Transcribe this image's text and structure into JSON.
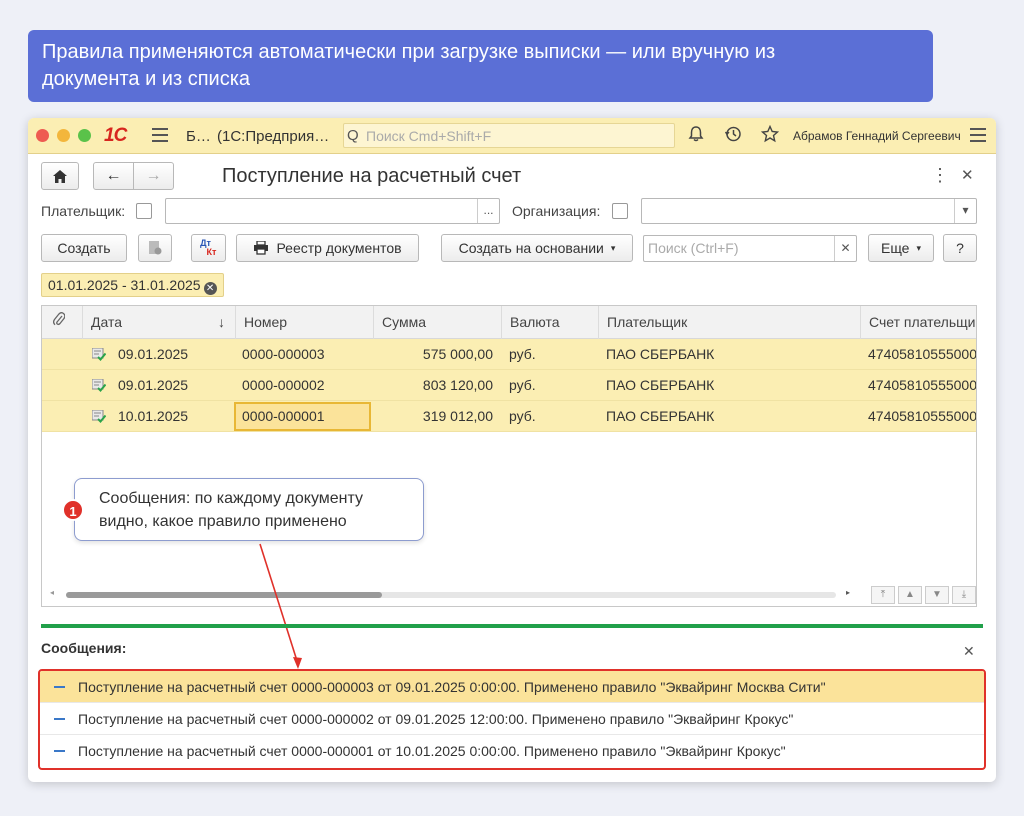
{
  "banner": {
    "line1": "Правила применяются автоматически при загрузке выписки — или вручную из",
    "line2": "документа и из списка"
  },
  "titlebar": {
    "logo": "1С",
    "app_short": "Б…",
    "app_name": "(1С:Предприя…",
    "search_placeholder": "Поиск Cmd+Shift+F",
    "user": "Абрамов Геннадий Сергеевич"
  },
  "form": {
    "title": "Поступление на расчетный счет",
    "payer_label": "Плательщик:",
    "org_label": "Организация:",
    "payer_select": "...",
    "create_label": "Создать",
    "dt_kt_top": "Дт",
    "dt_kt_bottom": "Кт",
    "registry_label": "Реестр документов",
    "create_based_label": "Создать на основании",
    "search_placeholder": "Поиск (Ctrl+F)",
    "more_label": "Еще",
    "help_label": "?"
  },
  "period": "01.01.2025 - 31.01.2025",
  "table": {
    "headers": {
      "date": "Дата",
      "number": "Номер",
      "sum": "Сумма",
      "currency": "Валюта",
      "payer": "Плательщик",
      "account": "Счет плательщика"
    },
    "sort_arrow": "↓",
    "rows": [
      {
        "date": "09.01.2025",
        "number": "0000-000003",
        "sum": "575 000,00",
        "currency": "руб.",
        "payer": "ПАО СБЕРБАНК",
        "account": "47405810555000"
      },
      {
        "date": "09.01.2025",
        "number": "0000-000002",
        "sum": "803 120,00",
        "currency": "руб.",
        "payer": "ПАО СБЕРБАНК",
        "account": "47405810555000"
      },
      {
        "date": "10.01.2025",
        "number": "0000-000001",
        "sum": "319 012,00",
        "currency": "руб.",
        "payer": "ПАО СБЕРБАНК",
        "account": "47405810555000"
      }
    ],
    "horizontal_scroll_fraction": 0.4
  },
  "callout": {
    "badge": "1",
    "line1": "Сообщения: по каждому документу",
    "line2": "видно, какое правило применено"
  },
  "messages": {
    "title": "Сообщения:",
    "items": [
      "Поступление на расчетный счет 0000-000003 от 09.01.2025 0:00:00. Применено правило \"Эквайринг Москва Сити\"",
      "Поступление на расчетный счет 0000-000002 от 09.01.2025 12:00:00. Применено правило \"Эквайринг Крокус\"",
      "Поступление на расчетный счет 0000-000001 от 10.01.2025 0:00:00. Применено правило \"Эквайринг Крокус\""
    ]
  },
  "colors": {
    "banner": "#5b6fd6",
    "titlebar": "#fbeeb3",
    "row_highlight": "#fbeeb3",
    "accent_red": "#e0312a",
    "separator_green": "#21a04a"
  }
}
